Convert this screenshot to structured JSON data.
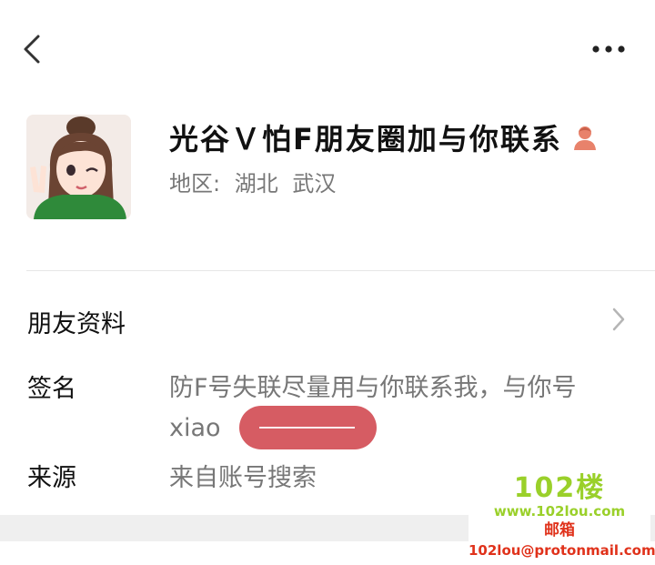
{
  "profile": {
    "nickname": "光谷Ｖ怕F朋友圈加与你联系",
    "region_label": "地区:",
    "province": "湖北",
    "city": "武汉",
    "gender": "female"
  },
  "rows": {
    "friend_info_label": "朋友资料",
    "signature_label": "签名",
    "signature_value": "防F号失联尽量用与你联系我，与你号xiao",
    "source_label": "来源",
    "source_value": "来自账号搜索"
  },
  "watermark": {
    "title": "102楼",
    "url": "www.102lou.com",
    "mail_label": "邮箱",
    "mail": "102lou@protonmail.com"
  },
  "colors": {
    "redaction": "#d65c63",
    "gender_icon": "#e8826b",
    "watermark_green": "#9ad02a",
    "watermark_red": "#e0321b"
  },
  "icons": {
    "back": "back-chevron-icon",
    "more": "more-dots-icon",
    "row_arrow": "chevron-right-icon"
  }
}
